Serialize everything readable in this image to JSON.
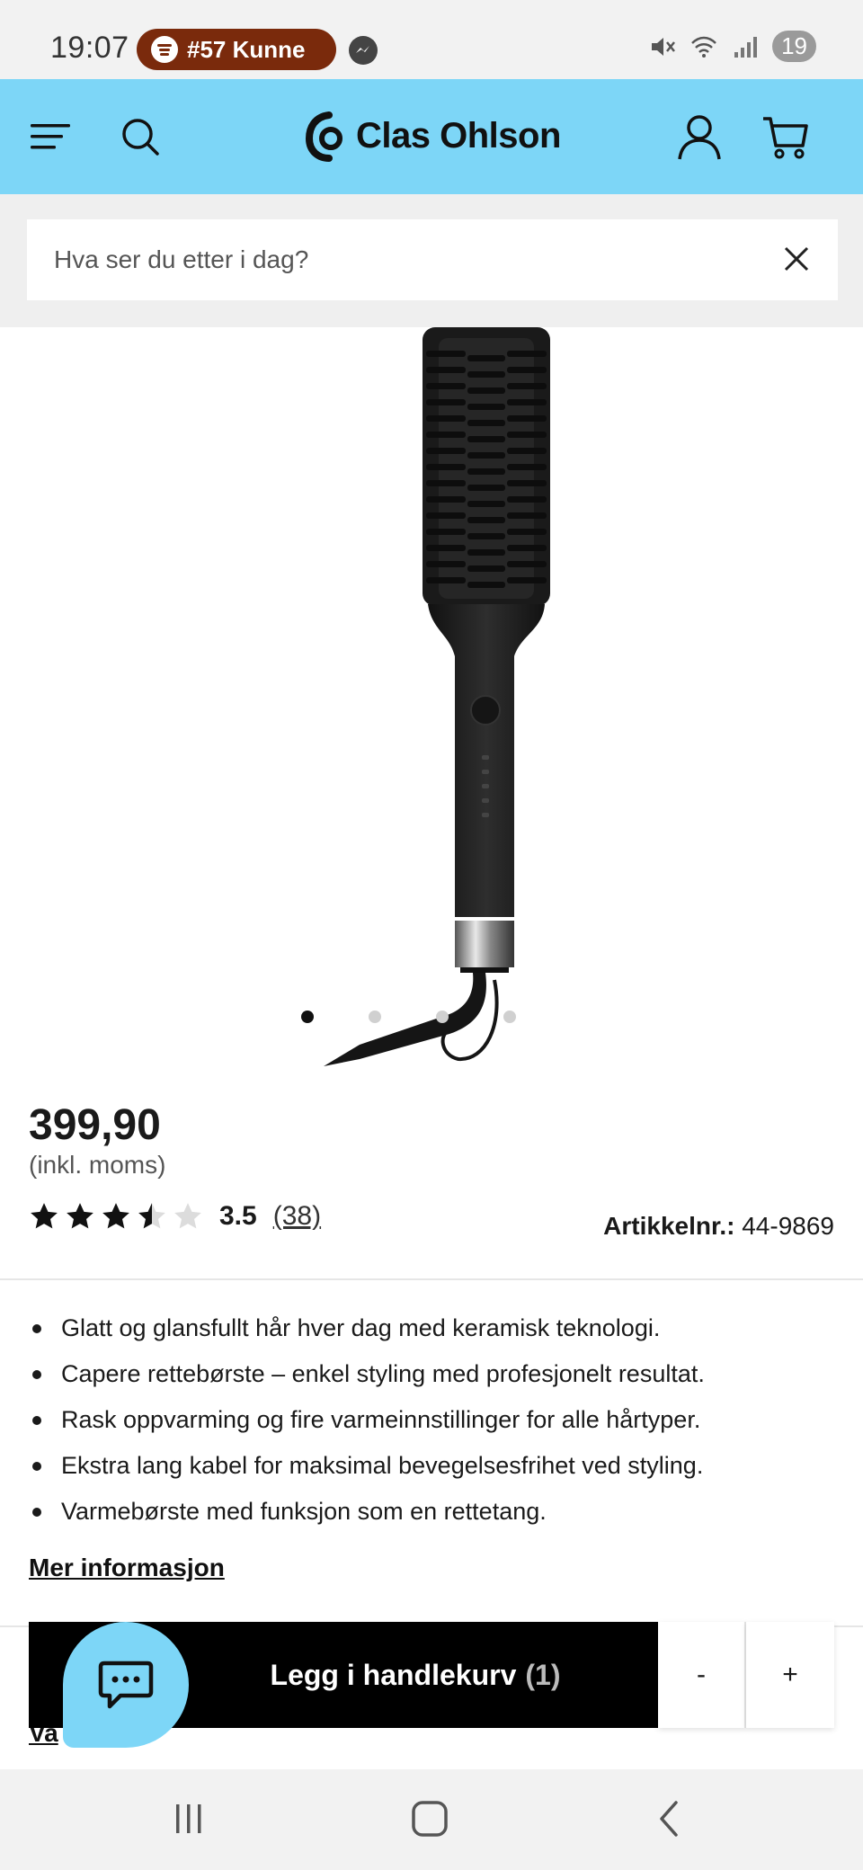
{
  "status_bar": {
    "time": "19:07",
    "now_playing": "#57 Kunne",
    "notification_count": "19"
  },
  "header": {
    "brand": "Clas Ohlson",
    "brand_color": "#7dd6f7",
    "icons": [
      "menu-icon",
      "search-icon",
      "account-icon",
      "cart-icon"
    ]
  },
  "search": {
    "placeholder": "Hva ser du etter i dag?"
  },
  "gallery": {
    "image_count": 4,
    "active_index": 0
  },
  "product": {
    "price": "399,90",
    "vat_note": "(inkl. moms)",
    "rating": {
      "value": "3.5",
      "stars": 3.5,
      "max_stars": 5,
      "count": "(38)"
    },
    "article_label": "Artikkelnr.:",
    "article_number": "44-9869",
    "features": [
      "Glatt og glansfullt hår hver dag med keramisk teknologi.",
      "Capere rettebørste – enkel styling med profesjonelt resultat.",
      "Rask oppvarming og fire varmeinnstillinger for alle hårtyper.",
      "Ekstra lang kabel for maksimal bevegelsesfrihet ved styling.",
      "Varmebørste med funksjon som en rettetang."
    ],
    "more_info": "Mer informasjon"
  },
  "cart_bar": {
    "add_label": "Legg i handlekurv",
    "add_count": "(1)",
    "minus": "-",
    "plus": "+",
    "partial_link": "Va"
  }
}
